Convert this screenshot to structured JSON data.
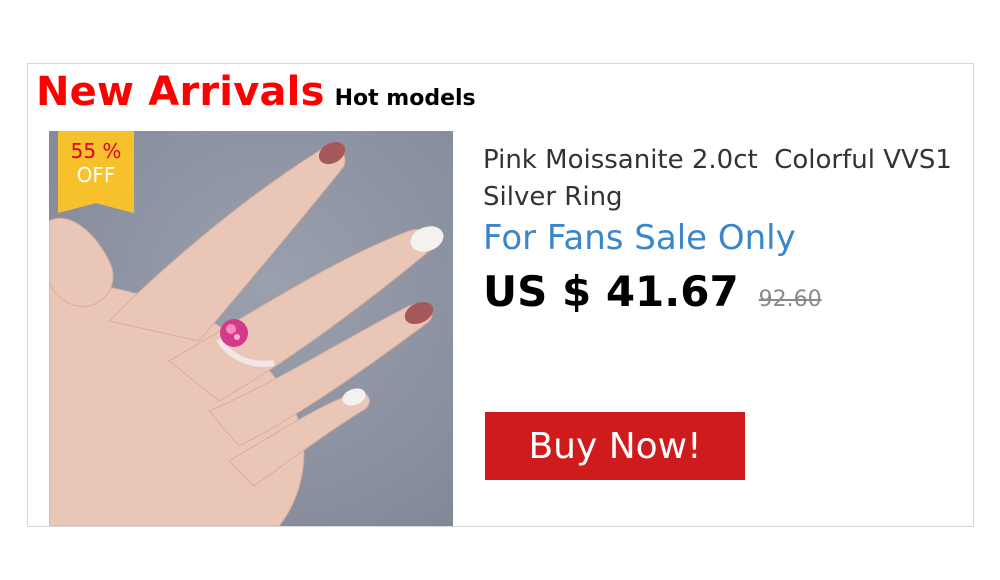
{
  "header": {
    "title": "New Arrivals",
    "subtitle": "Hot models"
  },
  "badge": {
    "percent": "55 %",
    "off": "OFF"
  },
  "product": {
    "name": "Pink Moissanite 2.0ct  Colorful VVS1  Silver Ring",
    "promo": "For Fans Sale Only",
    "price": "US $ 41.67",
    "original_price": "92.60"
  },
  "cta": {
    "label": "Buy Now!"
  },
  "colors": {
    "title_red": "#ff0000",
    "promo_blue": "#3a86c8",
    "badge_yellow": "#f7c12b",
    "button_red": "#cf1b1b"
  }
}
